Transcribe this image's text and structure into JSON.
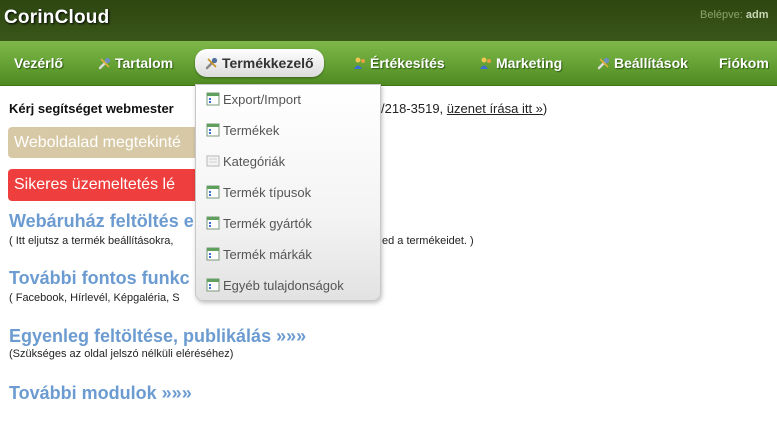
{
  "header": {
    "brand": "CorinCloud",
    "login_label": "Belépve:",
    "login_user": "adm"
  },
  "nav": {
    "items": [
      {
        "label": "Vezérlő",
        "icon": "none"
      },
      {
        "label": "Tartalom",
        "icon": "tools-icon"
      },
      {
        "label": "Termékkezelő",
        "icon": "tools-icon",
        "active": true
      },
      {
        "label": "Értékesítés",
        "icon": "users-icon"
      },
      {
        "label": "Marketing",
        "icon": "users-icon"
      },
      {
        "label": "Beállítások",
        "icon": "tools-icon"
      },
      {
        "label": "Fiókom",
        "icon": "none"
      }
    ]
  },
  "dropdown": {
    "items": [
      {
        "label": "Export/Import",
        "icon": "grid-icon"
      },
      {
        "label": "Termékek",
        "icon": "grid-icon"
      },
      {
        "label": "Kategóriák",
        "icon": "page-icon"
      },
      {
        "label": "Termék típusok",
        "icon": "grid-icon"
      },
      {
        "label": "Termék gyártók",
        "icon": "grid-icon"
      },
      {
        "label": "Termék márkák",
        "icon": "grid-icon"
      },
      {
        "label": "Egyéb tulajdonságok",
        "icon": "grid-icon"
      }
    ]
  },
  "content": {
    "help_text": "Kérj segítséget webmester",
    "help_tail": "/218-3519,",
    "help_link": "üzenet írása itt »",
    "help_close": ")",
    "bar_view": "Weboldalad megtekinté",
    "bar_success": "Sikeres üzemeltetés lé",
    "sections": [
      {
        "title": "Webáruház feltöltés e",
        "sub": "( Itt eljutsz a termék beállításokra,",
        "sub_tail": "ed a termékeidet. )"
      },
      {
        "title": "További fontos funkc",
        "sub": "( Facebook, Hírlevél, Képgaléria, S",
        "sub_tail": ""
      },
      {
        "title": "Egyenleg feltöltése, publikálás »»»",
        "sub": "(Szükséges az oldal jelszó nélküli eléréséhez)",
        "sub_tail": ""
      },
      {
        "title": "További modulok »»»",
        "sub": "",
        "sub_tail": ""
      }
    ]
  },
  "colors": {
    "header_bg": "#3a5618",
    "nav_bg": "#64a033",
    "link_blue": "#6b9bd0",
    "tan": "#d8c9a6",
    "red": "#ef3e3e"
  }
}
